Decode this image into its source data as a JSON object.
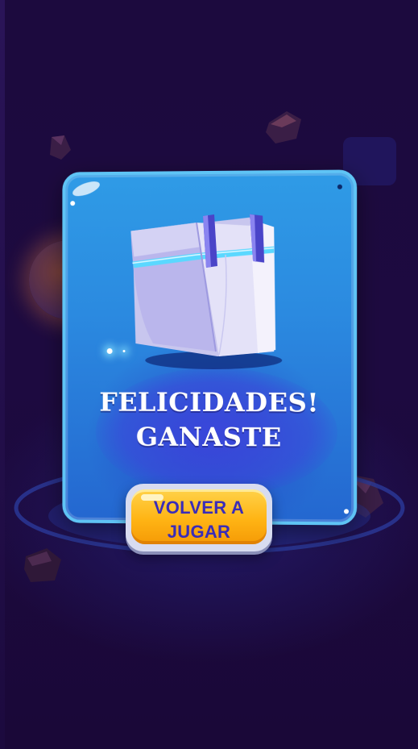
{
  "screen": {
    "title_line1": "FELICIDADES!",
    "title_line2": "GANASTE"
  },
  "actions": {
    "play_again_label_line1": "VOLVER A",
    "play_again_label_line2": "JUGAR"
  },
  "colors": {
    "background": "#1c0a3e",
    "card": "#2b8ae0",
    "card_border": "#5fc4f5",
    "button": "#ffb414",
    "button_text": "#3a2cb8",
    "title_text": "#ffffff"
  },
  "icons": {
    "reward": "treasure-chest-icon"
  }
}
